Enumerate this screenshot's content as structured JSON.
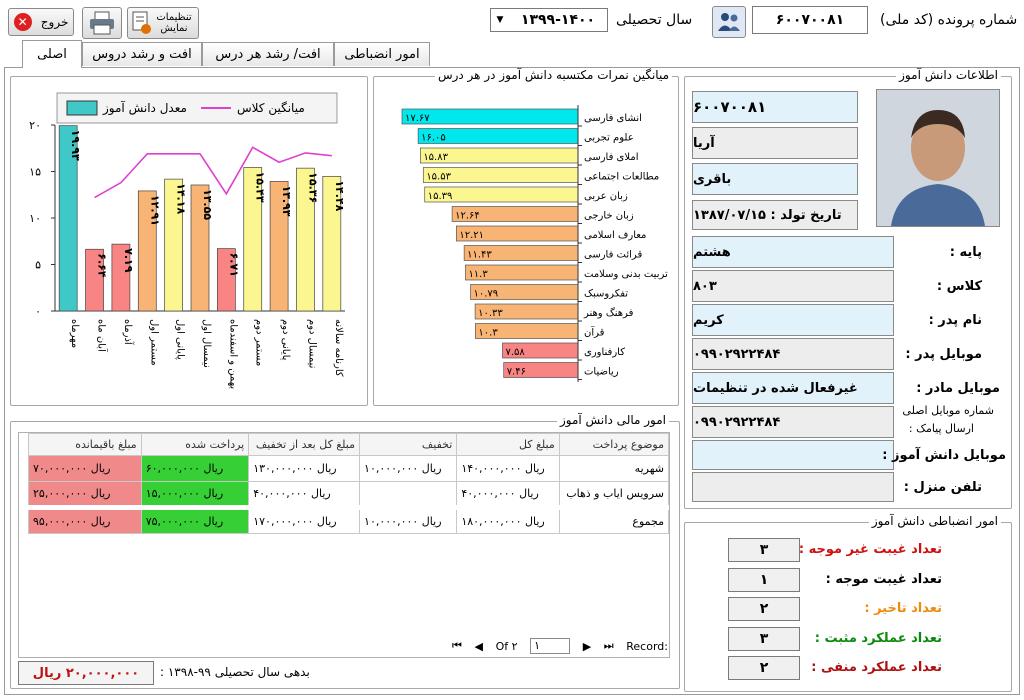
{
  "toolbar": {
    "exit_label": "خروج",
    "settings_label": "تنظیمات نمایش",
    "year_label": "سال تحصیلی",
    "year_value": "۱۳۹۹-۱۴۰۰",
    "national_code_label": "شماره پرونده (کد ملی)",
    "national_code_value": "۶۰۰۷۰۰۸۱"
  },
  "tabs": [
    "امور انضباطی",
    "افت/ رشد هر درس",
    "افت و رشد دروس",
    "اصلی"
  ],
  "active_tab": 3,
  "student_info": {
    "group_title": "اطلاعات دانش آموز",
    "code": "۶۰۰۷۰۰۸۱",
    "first_name": "آریا",
    "last_name": "باقری",
    "birth_date": "تاریخ تولد : ۱۳۸۷/۰۷/۱۵",
    "grade_label": "پایه :",
    "grade_value": "هشتم",
    "class_label": "کلاس :",
    "class_value": "۸۰۳",
    "father_name_label": "نام پدر :",
    "father_name_value": "کریم",
    "father_mobile_label": "موبایل پدر :",
    "father_mobile_value": "۰۹۹۰۲۹۲۲۴۸۴",
    "mother_mobile_label": "موبایل مادر :",
    "mother_mobile_value": "غیرفعال شده در تنظیمات",
    "sms_label_1": "شماره موبایل اصلی",
    "sms_label_2": "ارسال پیامک :",
    "sms_value": "۰۹۹۰۲۹۲۲۴۸۴",
    "student_mobile_label": "موبایل دانش آموز :",
    "student_mobile_value": "",
    "home_phone_label": "تلفن منزل :",
    "home_phone_value": ""
  },
  "discipline": {
    "group_title": "امور انضباطی دانش آموز",
    "items": [
      {
        "label": "تعداد غیبت غیر موجه :",
        "value": "۳",
        "color": "#d01010"
      },
      {
        "label": "تعداد غیبت موجه :",
        "value": "۱",
        "color": "#000000"
      },
      {
        "label": "تعداد تاخیر :",
        "value": "۲",
        "color": "#f08a10"
      },
      {
        "label": "تعداد عملکرد مثبت :",
        "value": "۳",
        "color": "#0a8a0a"
      },
      {
        "label": "تعداد عملکرد منفی :",
        "value": "۲",
        "color": "#b01010"
      }
    ]
  },
  "finance": {
    "group_title": "امور مالی دانش آموز",
    "headers": [
      "موضوع پرداخت",
      "مبلغ کل",
      "تخفیف",
      "مبلغ کل بعد از تخفیف",
      "پرداخت شده",
      "مبلغ باقیمانده"
    ],
    "rows": [
      [
        "شهریه",
        "ریال ۱۴۰,۰۰۰,۰۰۰",
        "ریال ۱۰,۰۰۰,۰۰۰",
        "ریال ۱۳۰,۰۰۰,۰۰۰",
        "ریال ۶۰,۰۰۰,۰۰۰",
        "ریال ۷۰,۰۰۰,۰۰۰"
      ],
      [
        "سرویس ایاب و ذهاب",
        "ریال ۴۰,۰۰۰,۰۰۰",
        "",
        "ریال ۴۰,۰۰۰,۰۰۰",
        "ریال ۱۵,۰۰۰,۰۰۰",
        "ریال ۲۵,۰۰۰,۰۰۰"
      ]
    ],
    "total": [
      "مجموع",
      "ریال ۱۸۰,۰۰۰,۰۰۰",
      "ریال ۱۰,۰۰۰,۰۰۰",
      "ریال ۱۷۰,۰۰۰,۰۰۰",
      "ریال ۷۵,۰۰۰,۰۰۰",
      "ریال ۹۵,۰۰۰,۰۰۰"
    ],
    "nav_record": "Record:",
    "nav_of": "Of ۲",
    "nav_current": "۱",
    "debt_label": "بدهی سال تحصیلی ۹۹-۱۳۹۸ :",
    "debt_value": "۲۰,۰۰۰,۰۰۰ ریال"
  },
  "chart_data": [
    {
      "type": "bar",
      "orientation": "horizontal",
      "title": "میانگین نمرات مکتسبه دانش آموز در هر درس",
      "categories": [
        "انشای فارسی",
        "علوم تجربی",
        "املای فارسی",
        "مطالعات اجتماعی",
        "زبان عربی",
        "زبان خارجی",
        "معارف اسلامی",
        "قرائت فارسی",
        "تربیت بدنی وسلامت",
        "تفکروسبک",
        "فرهنگ وهنر",
        "قرآن",
        "کارفناوری",
        "ریاضیات"
      ],
      "labels": [
        "۱۷.۶۷",
        "۱۶.۰۵",
        "۱۵.۸۳",
        "۱۵.۵۳",
        "۱۵.۳۹",
        "۱۲.۶۴",
        "۱۲.۲۱",
        "۱۱.۴۳",
        "۱۱.۳",
        "۱۰.۷۹",
        "۱۰.۳۳",
        "۱۰.۳",
        "۷.۵۸",
        "۷.۴۶"
      ],
      "values": [
        17.67,
        16.05,
        15.83,
        15.53,
        15.39,
        12.64,
        12.21,
        11.43,
        11.3,
        10.79,
        10.33,
        10.3,
        7.58,
        7.46
      ],
      "colors": {
        "high": "#00e8ec",
        "mid": "#fcf690",
        "low": "#f8b474",
        "fail": "#f88484"
      }
    },
    {
      "type": "bar",
      "title": "",
      "categories": [
        "مهرماه",
        "آبان ماه",
        "آذرماه",
        "مستمر اول",
        "پایانی اول",
        "نیمسال اول",
        "بهمن و اسفندماه",
        "مستمر دوم",
        "پایانی دوم",
        "نیمسال دوم",
        "کارنامه سالانه"
      ],
      "labels": [
        "۱۹.۹۳",
        "۶.۶۴",
        "۷.۱۹",
        "۱۲.۹۱",
        "۱۴.۱۸",
        "۱۳.۵۵",
        "۶.۷۱",
        "۱۵.۴۳",
        "۱۳.۹۳",
        "۱۵.۳۶",
        "۱۴.۴۸"
      ],
      "ylim": [
        0,
        20
      ],
      "yticks": [
        "۰",
        "۵",
        "۱۰",
        "۱۵",
        "۲۰"
      ],
      "series": [
        {
          "name": "معدل دانش آموز",
          "values": [
            19.93,
            6.64,
            7.19,
            12.91,
            14.18,
            13.55,
            6.71,
            15.43,
            13.93,
            15.36,
            14.48
          ],
          "colors": [
            "#40c8c8",
            "#f88484",
            "#f88484",
            "#f8b474",
            "#fcf690",
            "#f8b474",
            "#f88484",
            "#fcf690",
            "#f8b474",
            "#fcf690",
            "#fcf690"
          ]
        },
        {
          "name": "میانگین کلاس",
          "values": [
            null,
            12.2,
            13.8,
            16.9,
            16.9,
            16.9,
            12.6,
            17.6,
            16.0,
            17.0,
            16.7
          ],
          "color": "#e040d0"
        }
      ]
    }
  ]
}
